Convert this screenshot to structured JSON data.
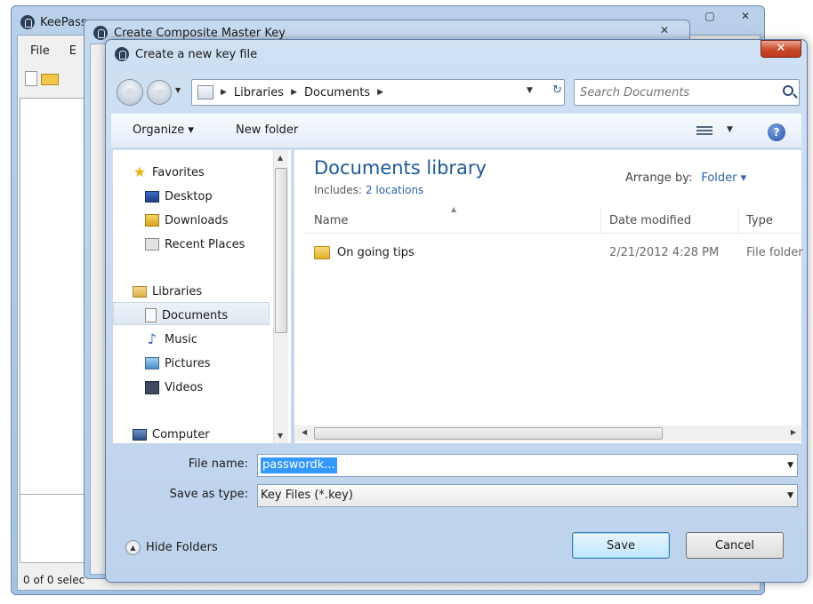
{
  "keepass": {
    "title": "KeePass",
    "menu": [
      "File",
      "E"
    ],
    "status": "0 of 0 selec"
  },
  "composite_dialog": {
    "title": "Create Composite Master Key",
    "close": "✕"
  },
  "save_dialog": {
    "title": "Create a new key file",
    "close": "✕",
    "address": {
      "crumbs": [
        "Libraries",
        "Documents"
      ]
    },
    "search": {
      "placeholder": "Search Documents"
    },
    "toolbar": {
      "organize": "Organize ▾",
      "new_folder": "New folder",
      "help": "?"
    },
    "nav": {
      "favorites": "Favorites",
      "desktop": "Desktop",
      "downloads": "Downloads",
      "recent": "Recent Places",
      "libraries": "Libraries",
      "documents": "Documents",
      "music": "Music",
      "pictures": "Pictures",
      "videos": "Videos",
      "computer": "Computer"
    },
    "library": {
      "title": "Documents library",
      "includes_label": "Includes:",
      "includes_link": "2 locations",
      "arrange_label": "Arrange by:",
      "arrange_value": "Folder ▾"
    },
    "columns": {
      "name": "Name",
      "date": "Date modified",
      "type": "Type"
    },
    "rows": [
      {
        "name": "On going tips",
        "date": "2/21/2012 4:28 PM",
        "type": "File folder"
      }
    ],
    "form": {
      "file_name_label": "File name:",
      "file_name_value": "passwordk...",
      "save_type_label": "Save as type:",
      "save_type_value": "Key Files (*.key)"
    },
    "hide_folders": "Hide Folders",
    "save_button": "Save",
    "cancel_button": "Cancel"
  },
  "colors": {
    "accent": "#1e5a96",
    "link": "#2b62a8",
    "selection": "#3399ff",
    "close_red": "#c84a2c"
  }
}
